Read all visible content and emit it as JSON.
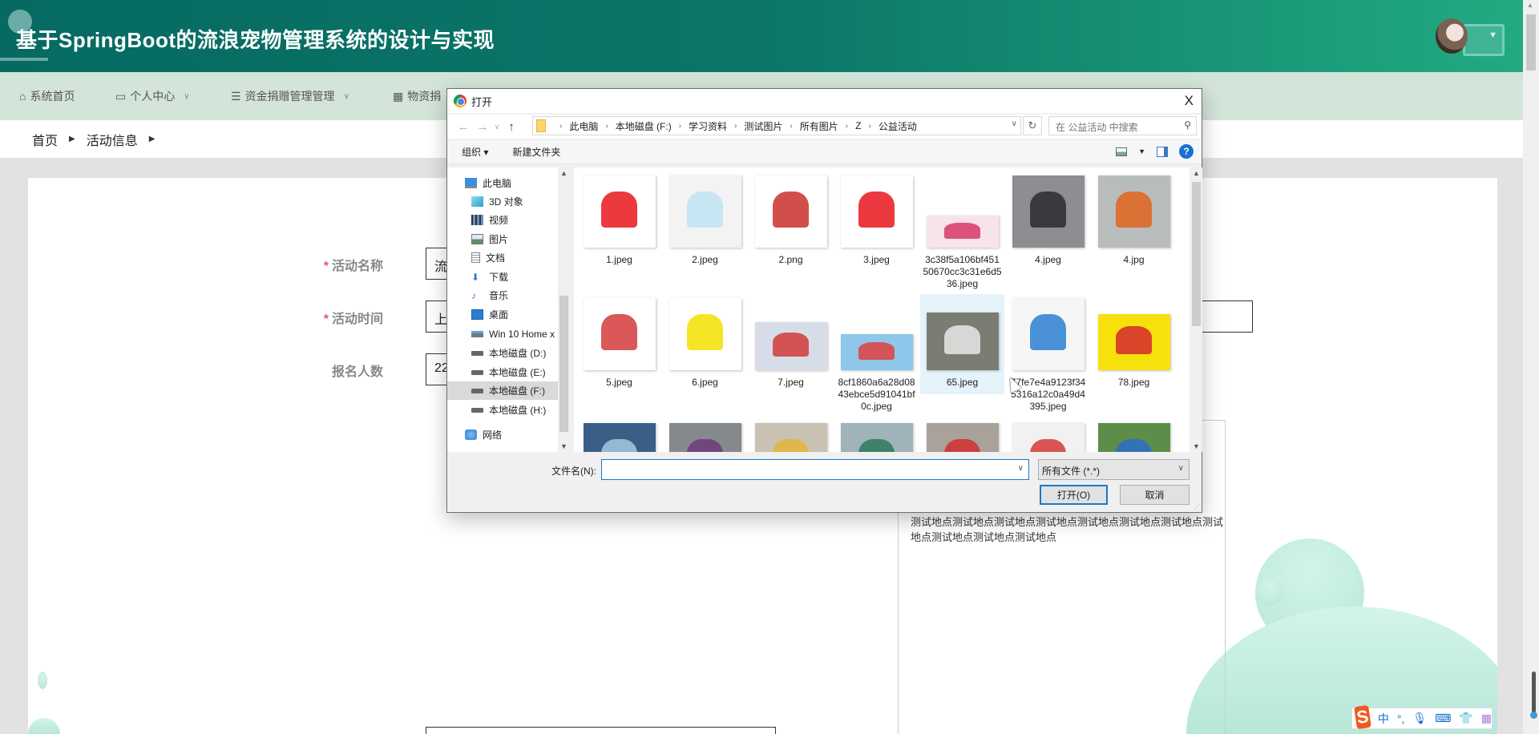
{
  "header": {
    "title": "基于SpringBoot的流浪宠物管理系统的设计与实现"
  },
  "nav": [
    {
      "label": "系统首页",
      "icon": "home-icon"
    },
    {
      "label": "个人中心",
      "icon": "user-card-icon"
    },
    {
      "label": "资金捐赠管理管理",
      "icon": "list-icon"
    },
    {
      "label": "物资捐",
      "icon": "grid-icon"
    }
  ],
  "breadcrumb": [
    "首页",
    "活动信息"
  ],
  "form": {
    "required_mark": "*",
    "fields": [
      {
        "label": "活动名称",
        "value": "流",
        "required": true
      },
      {
        "label": "活动时间",
        "value": "上",
        "required": true
      },
      {
        "label": "报名人数",
        "value": "22",
        "required": false
      }
    ],
    "location_text": "测试地点测试地点测试地点测试地点测试地点测试地点测试地点测试地点测试地点测试地点测试地点"
  },
  "dialog": {
    "title": "打开",
    "close": "X",
    "path": [
      "此电脑",
      "本地磁盘 (F:)",
      "学习资料",
      "测试图片",
      "所有图片",
      "Z",
      "公益活动"
    ],
    "search_placeholder": "在 公益活动 中搜索",
    "toolbar": {
      "organize": "组织 ▾",
      "new_folder": "新建文件夹",
      "help": "?"
    },
    "tree": [
      {
        "label": "此电脑",
        "icon": "computer-icon"
      },
      {
        "label": "3D 对象",
        "icon": "cube-icon"
      },
      {
        "label": "视频",
        "icon": "video-icon"
      },
      {
        "label": "图片",
        "icon": "picture-icon"
      },
      {
        "label": "文档",
        "icon": "document-icon"
      },
      {
        "label": "下载",
        "icon": "download-icon"
      },
      {
        "label": "音乐",
        "icon": "music-icon"
      },
      {
        "label": "桌面",
        "icon": "desktop-icon"
      },
      {
        "label": "Win 10 Home x",
        "icon": "network-drive-icon"
      },
      {
        "label": "本地磁盘 (D:)",
        "icon": "drive-icon"
      },
      {
        "label": "本地磁盘 (E:)",
        "icon": "drive-icon"
      },
      {
        "label": "本地磁盘 (F:)",
        "icon": "drive-icon",
        "selected": true
      },
      {
        "label": "本地磁盘 (H:)",
        "icon": "drive-icon"
      },
      {
        "label": "网络",
        "icon": "network-icon"
      }
    ],
    "files": [
      {
        "name": "1.jpeg",
        "color": "#ffffff",
        "accent": "#e8161d"
      },
      {
        "name": "2.jpeg",
        "color": "#f3f3f3",
        "accent": "#bfe2f3"
      },
      {
        "name": "2.png",
        "color": "#ffffff",
        "accent": "#c9302c"
      },
      {
        "name": "3.jpeg",
        "color": "#ffffff",
        "accent": "#e8161d"
      },
      {
        "name": "3c38f5a106bf45150670cc3c31e6d536.jpeg",
        "color": "#f7e4ea",
        "accent": "#d6386a"
      },
      {
        "name": "4.jpeg",
        "color": "#8d8d92",
        "accent": "#2a2a30"
      },
      {
        "name": "4.jpg",
        "color": "#b9bcbc",
        "accent": "#e0641c"
      },
      {
        "name": "5.jpeg",
        "color": "#ffffff",
        "accent": "#d33b3b"
      },
      {
        "name": "6.jpeg",
        "color": "#ffffff",
        "accent": "#f5e000"
      },
      {
        "name": "7.jpeg",
        "color": "#d7dde8",
        "accent": "#d23a3a"
      },
      {
        "name": "8cf1860a6a28d0843ebce5d91041bf0c.jpeg",
        "color": "#8fc7ea",
        "accent": "#e04040"
      },
      {
        "name": "65.jpeg",
        "color": "#7a7d72",
        "accent": "#e7e7e7",
        "selected": true
      },
      {
        "name": "77fe7e4a9123f345316a12c0a49d4395.jpeg",
        "color": "#f6f6f6",
        "accent": "#2b7fd2"
      },
      {
        "name": "78.jpeg",
        "color": "#f7e10c",
        "accent": "#d5282e"
      },
      {
        "name": "",
        "color": "#3a5f86",
        "accent": "#a6c8e0"
      },
      {
        "name": "",
        "color": "#85898c",
        "accent": "#6d3b7a"
      },
      {
        "name": "",
        "color": "#c9c2b2",
        "accent": "#e2b53a"
      },
      {
        "name": "",
        "color": "#9fb3b9",
        "accent": "#2c7a5a"
      },
      {
        "name": "",
        "color": "#a9a29a",
        "accent": "#d22f2f"
      },
      {
        "name": "",
        "color": "#f1f1f1",
        "accent": "#d23a3a"
      },
      {
        "name": "",
        "color": "#5c8e4a",
        "accent": "#2a6fc9"
      }
    ],
    "filename_label": "文件名(N):",
    "filename_value": "",
    "filetype": "所有文件 (*.*)",
    "open_label": "打开(O)",
    "cancel_label": "取消"
  },
  "ime": {
    "logo": "S",
    "mode": "中",
    "punct": "°,",
    "items": [
      "mic-icon",
      "keyboard-icon",
      "skin-icon",
      "apps-icon"
    ]
  }
}
